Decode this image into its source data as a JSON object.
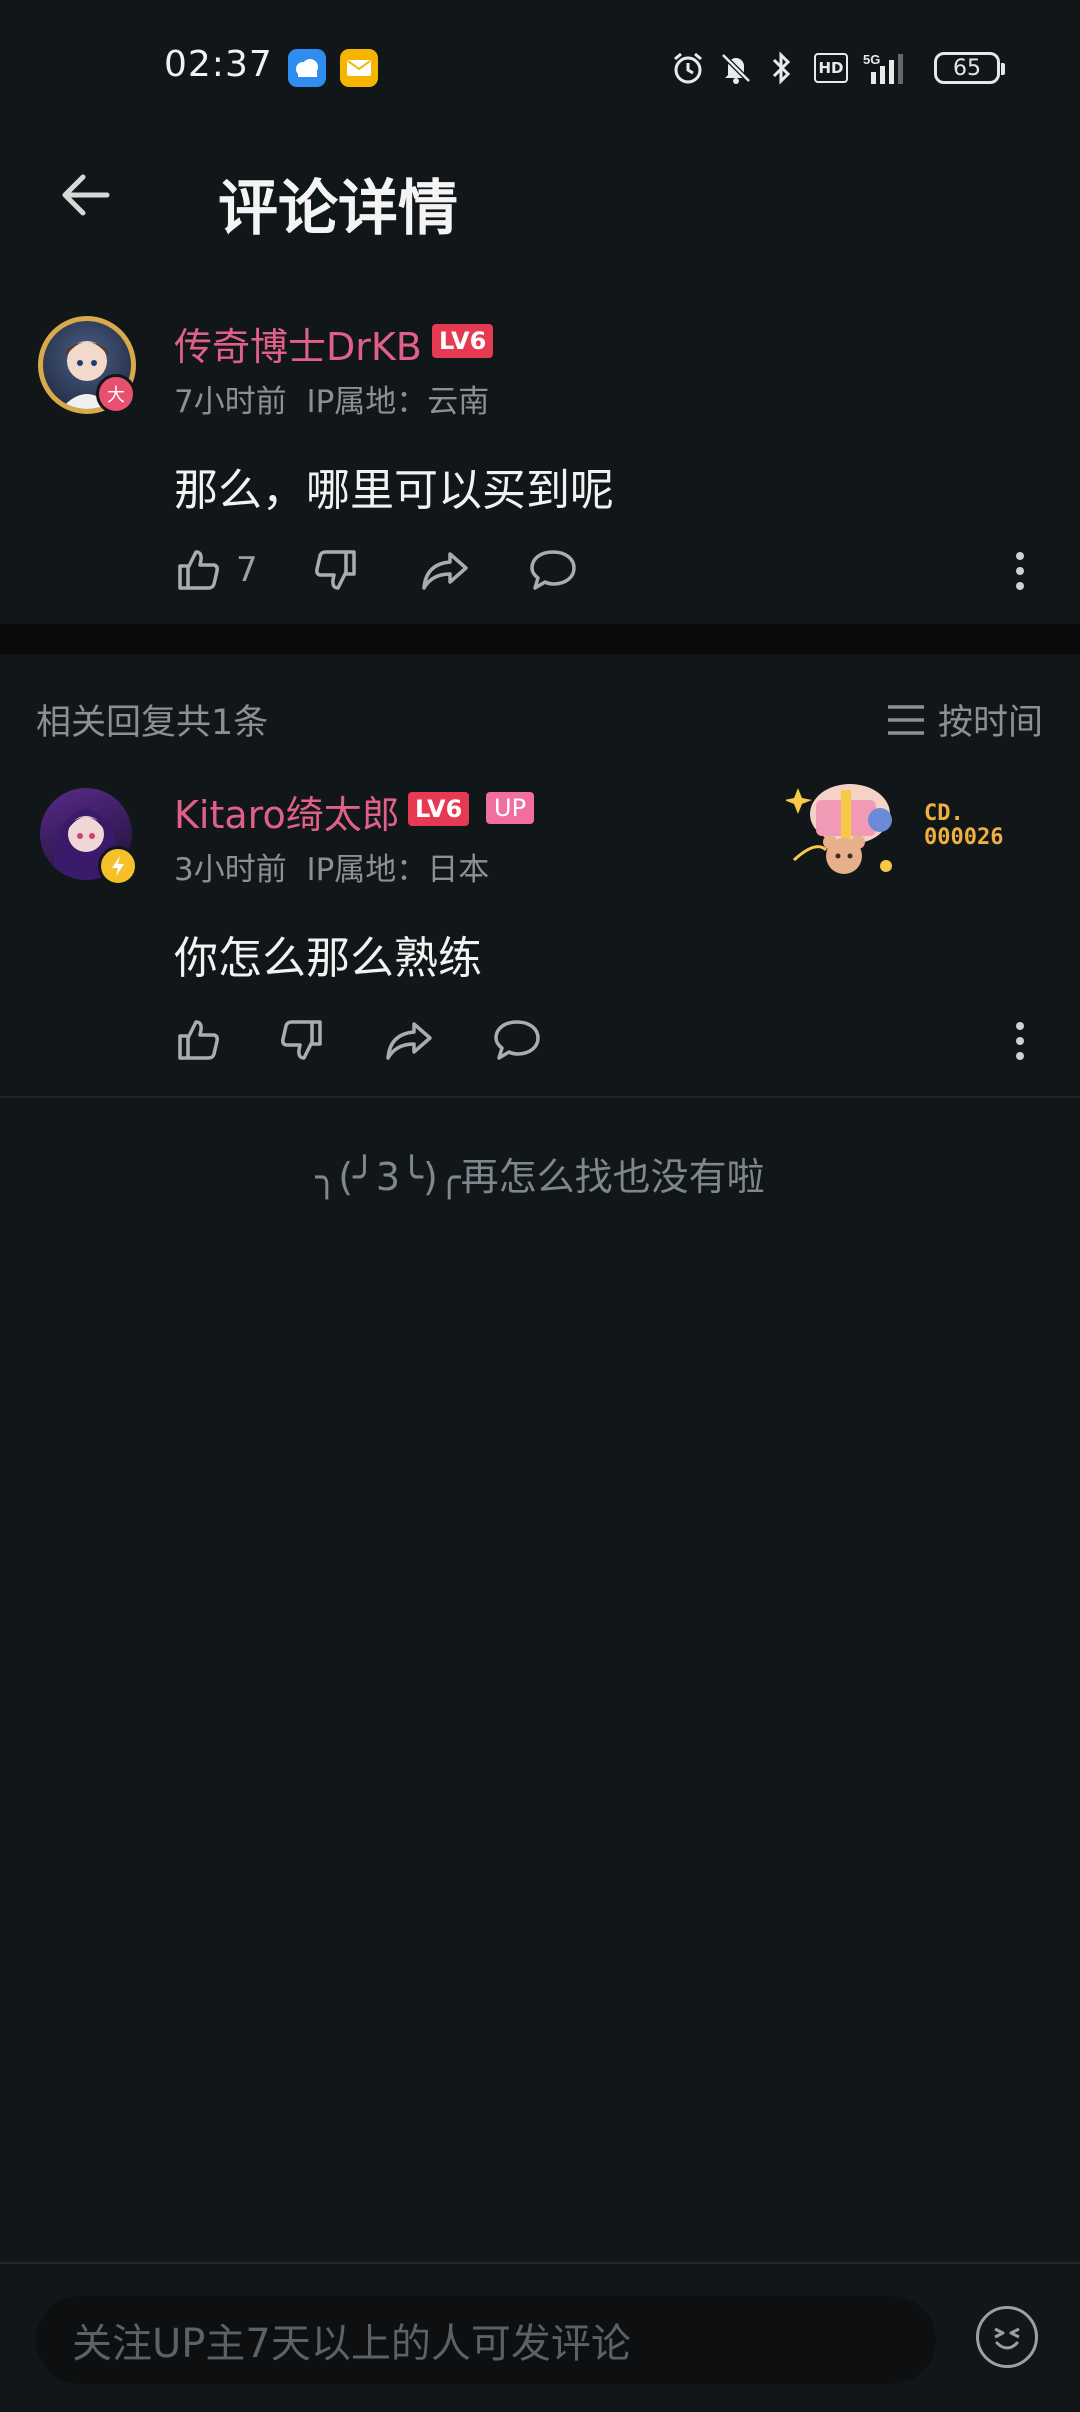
{
  "status_bar": {
    "time": "02:37",
    "battery": "65",
    "icons": [
      "weather-app-icon",
      "mail-app-icon",
      "alarm-icon",
      "mute-icon",
      "bluetooth-icon",
      "hd-icon",
      "5g-signal-icon",
      "battery-icon"
    ]
  },
  "header": {
    "title": "评论详情"
  },
  "main_comment": {
    "username": "传奇博士DrKB",
    "level": "LV6",
    "time": "7小时前",
    "ip": "IP属地：云南",
    "text": "那么，哪里可以买到呢",
    "like_count": "7",
    "avatar_badge": "大"
  },
  "replies_section": {
    "label": "相关回复共1条",
    "sort_label": "按时间"
  },
  "reply": {
    "username": "Kitaro绮太郎",
    "level": "LV6",
    "up_badge": "UP",
    "time": "3小时前",
    "ip": "IP属地：日本",
    "text": "你怎么那么熟练",
    "fan_card_label": "CD.",
    "fan_card_number": "000026"
  },
  "end_message": "╮(╯3╰)╭再怎么找也没有啦",
  "bottom": {
    "placeholder": "关注UP主7天以上的人可发评论"
  },
  "colors": {
    "background": "#111618",
    "name_pink": "#e0608a",
    "level_red": "#e63a52",
    "muted": "#8b9096"
  }
}
